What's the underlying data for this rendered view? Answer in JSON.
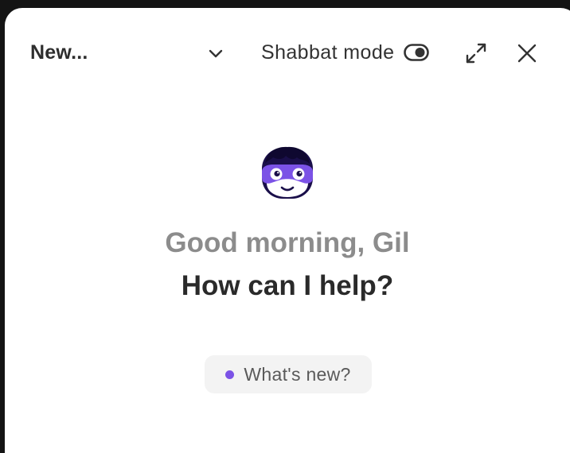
{
  "header": {
    "title": "New...",
    "shabbat_label": "Shabbat mode",
    "icons": {
      "chevron": "chevron-down-icon",
      "toggle": "toggle-icon",
      "expand": "expand-icon",
      "close": "close-icon"
    }
  },
  "assistant": {
    "greeting": "Good morning, Gil",
    "prompt": "How can I help?",
    "avatar": "avatar-icon"
  },
  "whats_new": {
    "label": "What's new?",
    "dot_color": "#7b52e6"
  },
  "colors": {
    "accent": "#7b52e6",
    "panel_background": "#ffffff",
    "outer_background": "#141414"
  }
}
